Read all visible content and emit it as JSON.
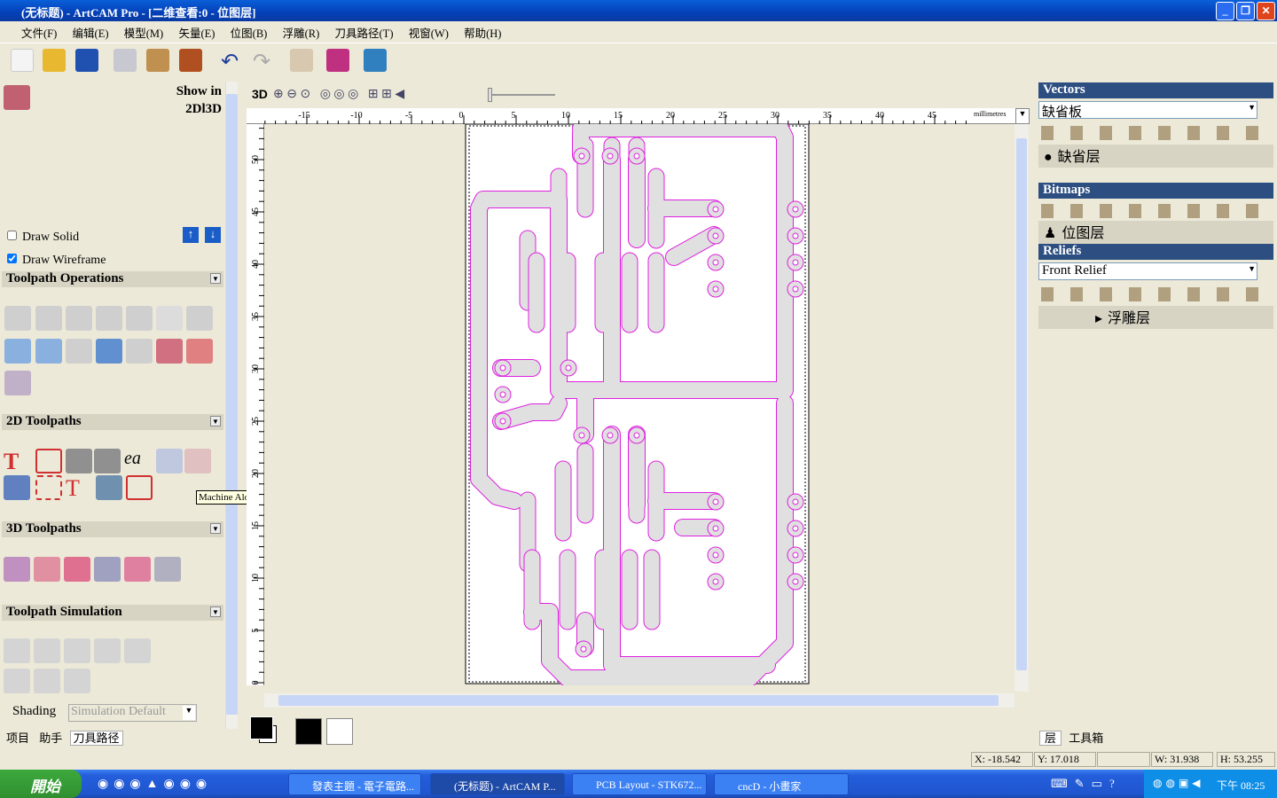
{
  "window": {
    "title": "(无标题) - ArtCAM Pro - [二维查看:0 - 位图层]",
    "minimize": "_",
    "restore": "❐",
    "close": "✕"
  },
  "menu": [
    "文件(F)",
    "编辑(E)",
    "模型(M)",
    "矢量(E)",
    "位图(B)",
    "浮雕(R)",
    "刀具路径(T)",
    "视窗(W)",
    "帮助(H)"
  ],
  "left": {
    "show_in": "Show in",
    "show_in_mode": "2Dl3D",
    "draw_solid": {
      "label": "Draw Solid",
      "checked": false
    },
    "draw_wireframe": {
      "label": "Draw Wireframe",
      "checked": true
    },
    "sections": [
      "Toolpath Operations",
      "2D Toolpaths",
      "3D Toolpaths",
      "Toolpath Simulation"
    ],
    "shading_label": "Shading",
    "shading_value": "Simulation Default",
    "tabs": [
      "项目",
      "助手",
      "刀具路径"
    ],
    "tooltip": "Machine Along Vector"
  },
  "view": {
    "mode_3d": "3D",
    "units": "millimetres",
    "x_ticks": [
      "-15",
      "-10",
      "-5",
      "0",
      "5",
      "10",
      "15",
      "20",
      "25",
      "30",
      "35",
      "40",
      "45"
    ],
    "y_ticks": [
      "50",
      "45",
      "40",
      "35",
      "30",
      "25",
      "20",
      "15",
      "10",
      "5",
      "0"
    ]
  },
  "right": {
    "vectors": {
      "title": "Vectors",
      "select": "缺省板",
      "layer": "缺省层"
    },
    "bitmaps": {
      "title": "Bitmaps",
      "layer": "位图层"
    },
    "reliefs": {
      "title": "Reliefs",
      "select": "Front Relief",
      "layer": "浮雕层"
    },
    "tabs": [
      "层",
      "工具箱"
    ]
  },
  "status": {
    "x": "X: -18.542",
    "y": "Y: 17.018",
    "w": "W: 31.938",
    "h": "H: 53.255"
  },
  "taskbar": {
    "start": "開始",
    "tasks": [
      "發表主題 - 電子電路...",
      "(无标题) - ArtCAM P...",
      "PCB Layout - STK672...",
      "cncD - 小畫家"
    ],
    "clock": "下午 08:25"
  },
  "colors": {
    "trace_fill": "#e0e0e0",
    "trace_outline": "#e020e0",
    "panel_header": "#2c4e80"
  }
}
